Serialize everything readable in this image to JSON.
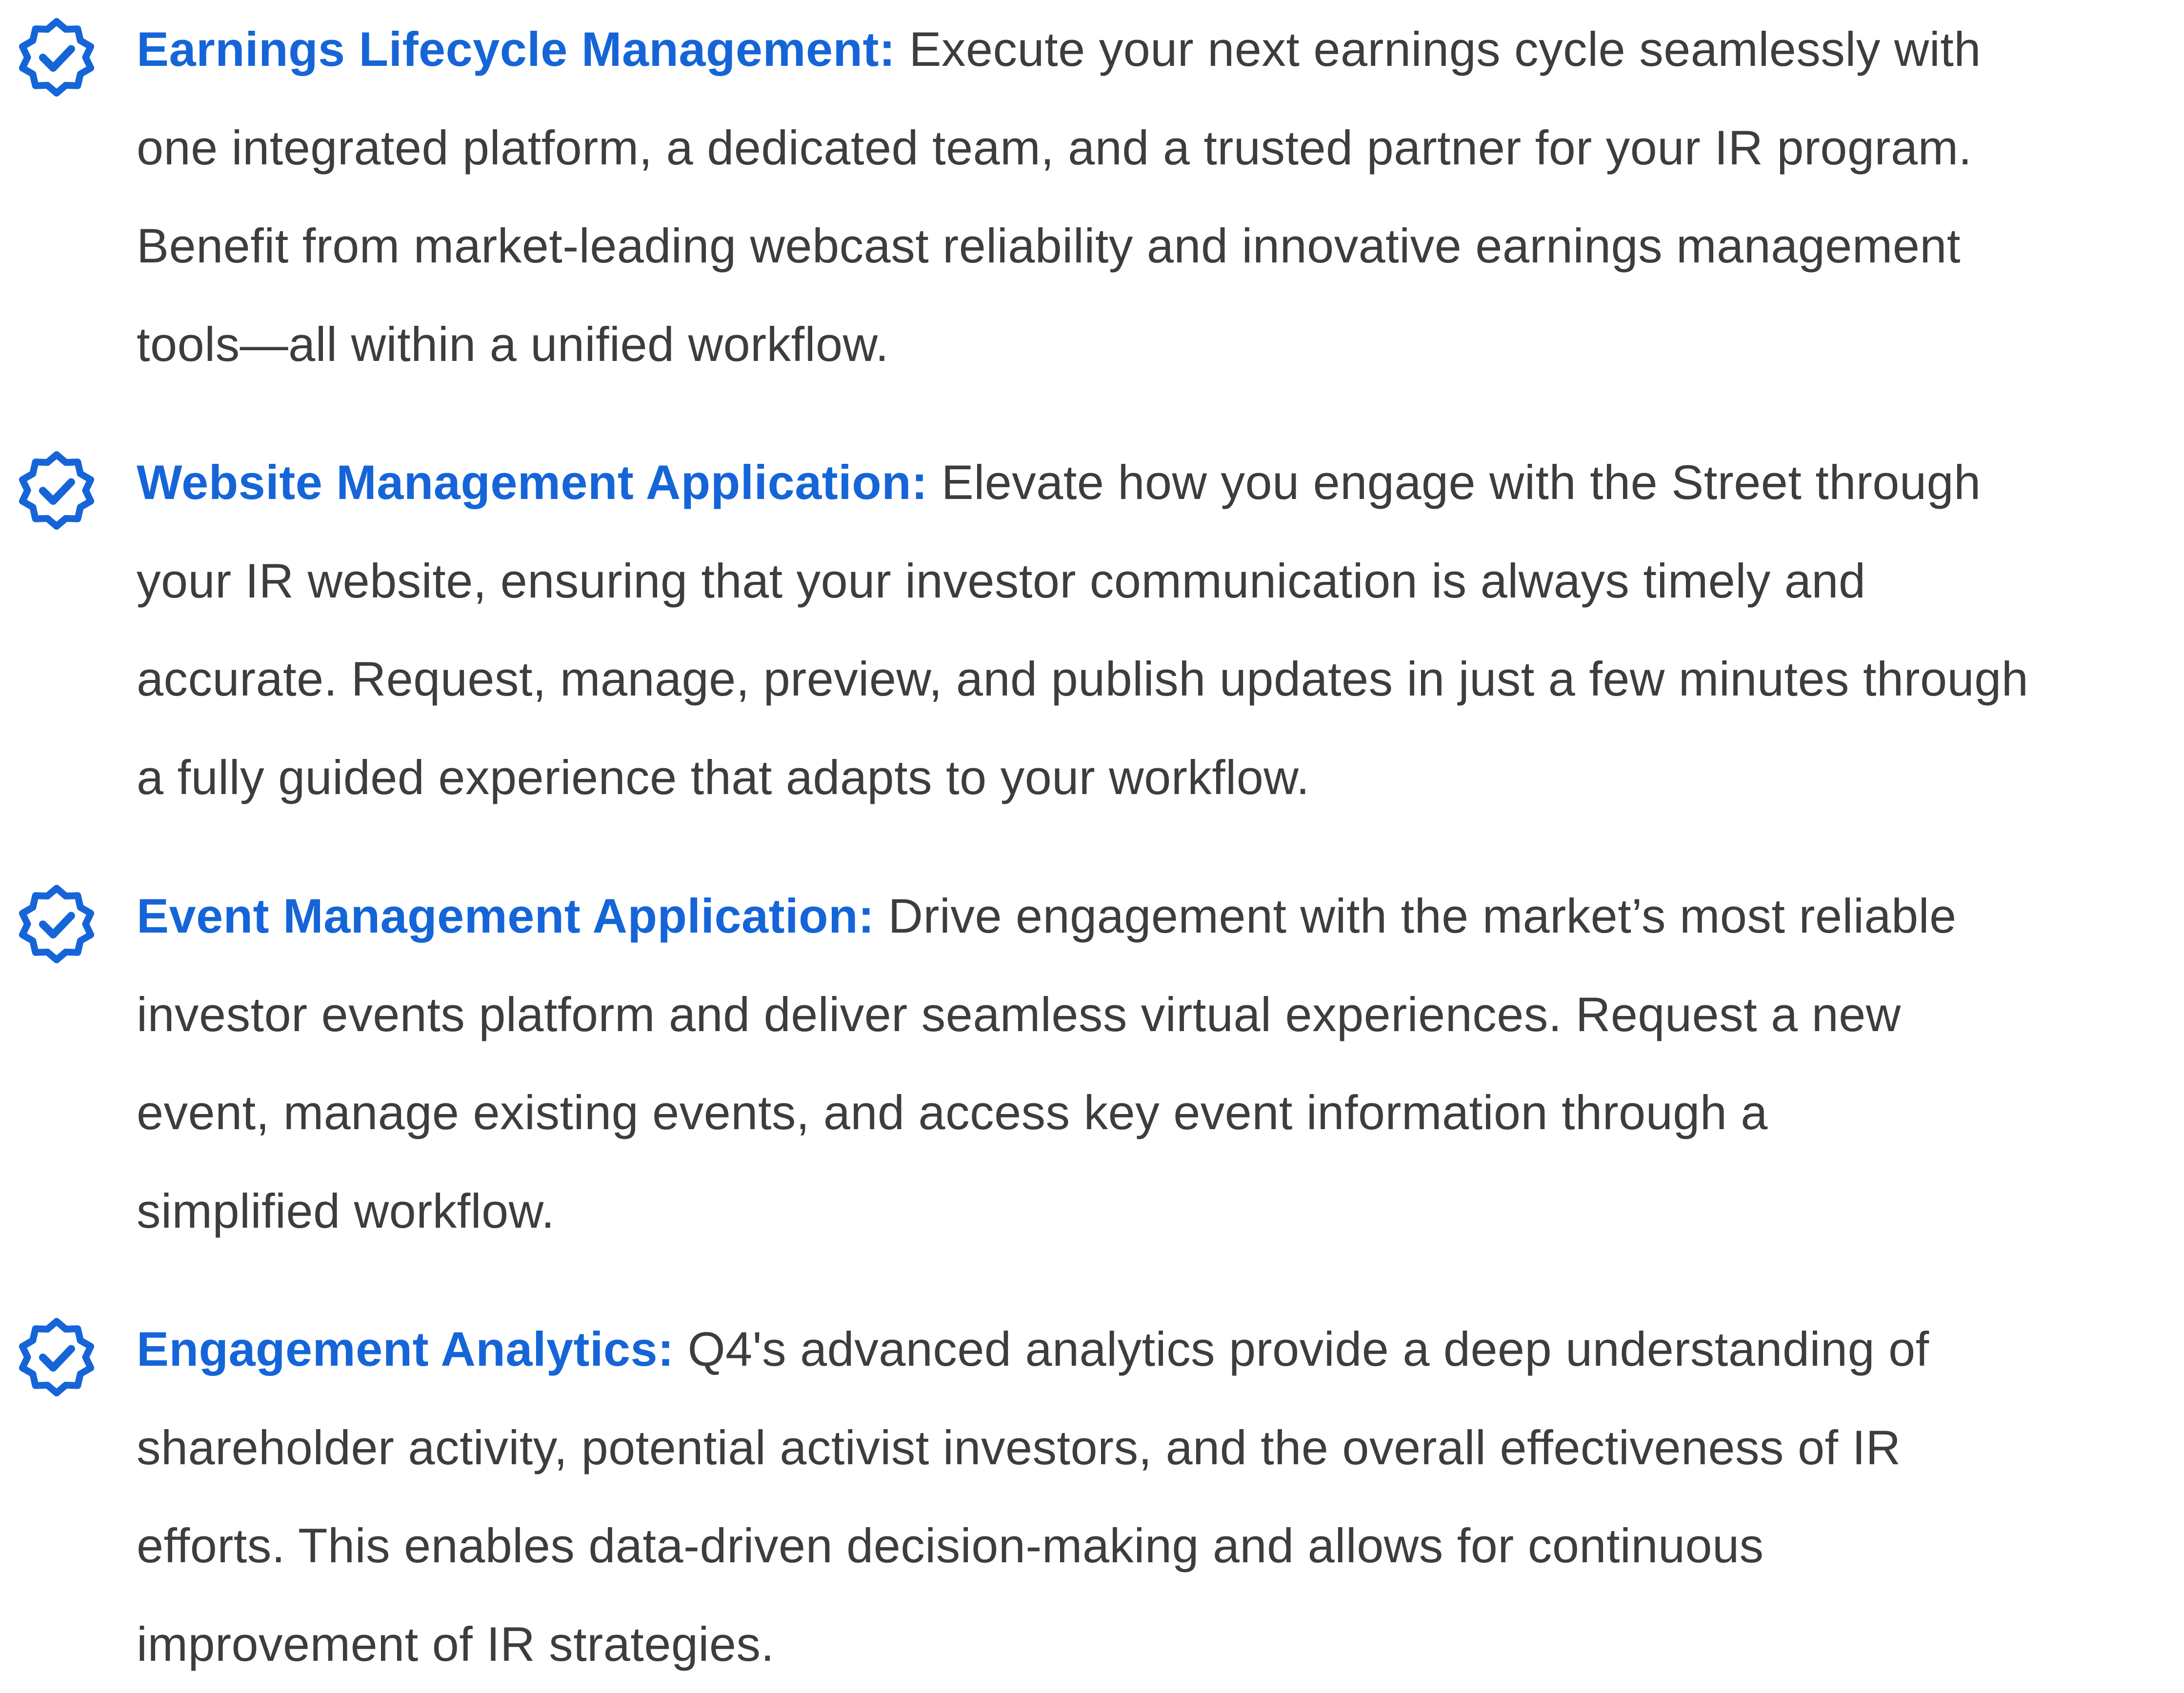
{
  "accent_color": "#1565d8",
  "text_color": "#3d3d3d",
  "icon": "verified-badge-check-icon",
  "features": [
    {
      "title": "Earnings Lifecycle Management:",
      "lines": [
        "Execute your next earnings cycle seamlessly with",
        "one integrated platform, a dedicated team, and a trusted partner for your IR program.",
        "Benefit from market-leading webcast reliability and innovative earnings management",
        "tools—all within a unified workflow."
      ]
    },
    {
      "title": "Website Management Application:",
      "lines": [
        "Elevate how you engage with the Street through",
        "your IR website, ensuring that your investor communication is always timely and",
        "accurate. Request, manage, preview, and publish updates in just a few minutes through",
        "a fully guided experience that adapts to your workflow."
      ]
    },
    {
      "title": "Event Management Application:",
      "lines": [
        "Drive engagement with the market’s most reliable",
        "investor events platform and deliver seamless virtual experiences. Request a new",
        "event, manage existing events, and access key event information through a",
        "simplified workflow."
      ]
    },
    {
      "title": "Engagement Analytics:",
      "lines": [
        "Q4's advanced analytics provide a deep understanding of",
        "shareholder activity, potential activist investors, and the overall effectiveness of IR",
        "efforts. This enables data-driven decision-making and allows for continuous",
        "improvement of IR strategies."
      ]
    }
  ]
}
